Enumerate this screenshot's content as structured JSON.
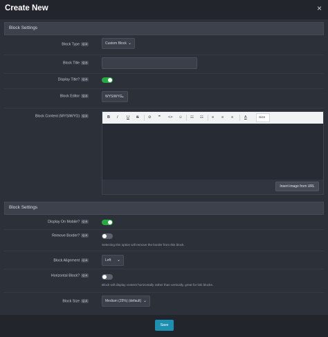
{
  "dialog": {
    "title": "Create New",
    "close_icon": "×"
  },
  "section1": {
    "header": "Block Settings",
    "block_type": {
      "label": "Block Type",
      "badge": "Q &",
      "value": "Custom Block",
      "chevron": "⌄"
    },
    "block_title": {
      "label": "Block Title",
      "badge": "Q &",
      "value": ""
    },
    "display_title": {
      "label": "Display Title?",
      "badge": "Q &",
      "state": "on"
    },
    "block_editor": {
      "label": "Block Editor",
      "badge": "Q &",
      "value": "WYSIWYG",
      "chevron": "⌄"
    },
    "block_content": {
      "label": "Block Content (WYSIWYG)",
      "badge": "Q &",
      "toolbar": {
        "bold": "B",
        "italic": "I",
        "underline": "U",
        "strikethrough": "S",
        "link": "⊘",
        "quote": "❞",
        "code": "<>",
        "emoji": "☺",
        "bullet_list": "☷",
        "numbered_list": "☷",
        "align_left": "≡",
        "align_center": "≡",
        "align_right": "≡",
        "text_color": "A",
        "size_label": "Size"
      },
      "insert_button": "Insert image from URL"
    }
  },
  "section2": {
    "header": "Block Settings",
    "display_on_mobile": {
      "label": "Display On Mobile?",
      "badge": "Q &",
      "state": "on"
    },
    "remove_border": {
      "label": "Remove Border?",
      "badge": "Q &",
      "state": "off",
      "help": "Selecting this option will remove the border from this block."
    },
    "block_alignment": {
      "label": "Block Alignment",
      "badge": "Q &",
      "value": "Left",
      "chevron": "⌄"
    },
    "horizontal_block": {
      "label": "Horizontal Block?",
      "badge": "Q &",
      "state": "off",
      "help": "Block will display content horizontally rather than vertically, great for link blocks."
    },
    "block_size": {
      "label": "Block Size",
      "badge": "Q &",
      "value": "Medium (25%) (default)",
      "chevron": "⌄"
    }
  },
  "footer": {
    "save_label": "Save"
  },
  "colors": {
    "accent": "#1d8fb0",
    "toggle_on": "#28a745",
    "background": "#2c3039"
  }
}
